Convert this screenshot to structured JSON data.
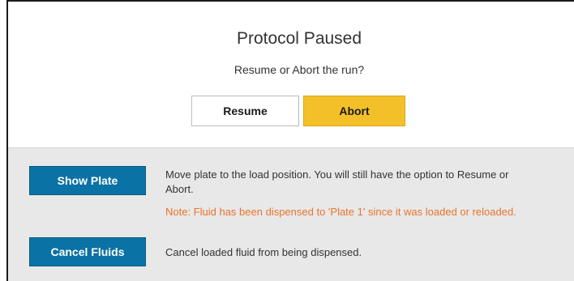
{
  "dialog": {
    "title": "Protocol Paused",
    "subtitle": "Resume or Abort the run?",
    "resume_label": "Resume",
    "abort_label": "Abort"
  },
  "actions": {
    "show_plate_label": "Show Plate",
    "show_plate_desc": "Move plate to the load position. You will still have the option to Resume or Abort.",
    "show_plate_note": "Note: Fluid has been dispensed to 'Plate 1' since it was loaded or reloaded.",
    "cancel_fluids_label": "Cancel Fluids",
    "cancel_fluids_desc": "Cancel loaded fluid from being dispensed."
  },
  "colors": {
    "abort": "#f4c02a",
    "primary_blue": "#0b72a6",
    "note": "#e8742c",
    "panel_bg": "#e8e8e8"
  }
}
